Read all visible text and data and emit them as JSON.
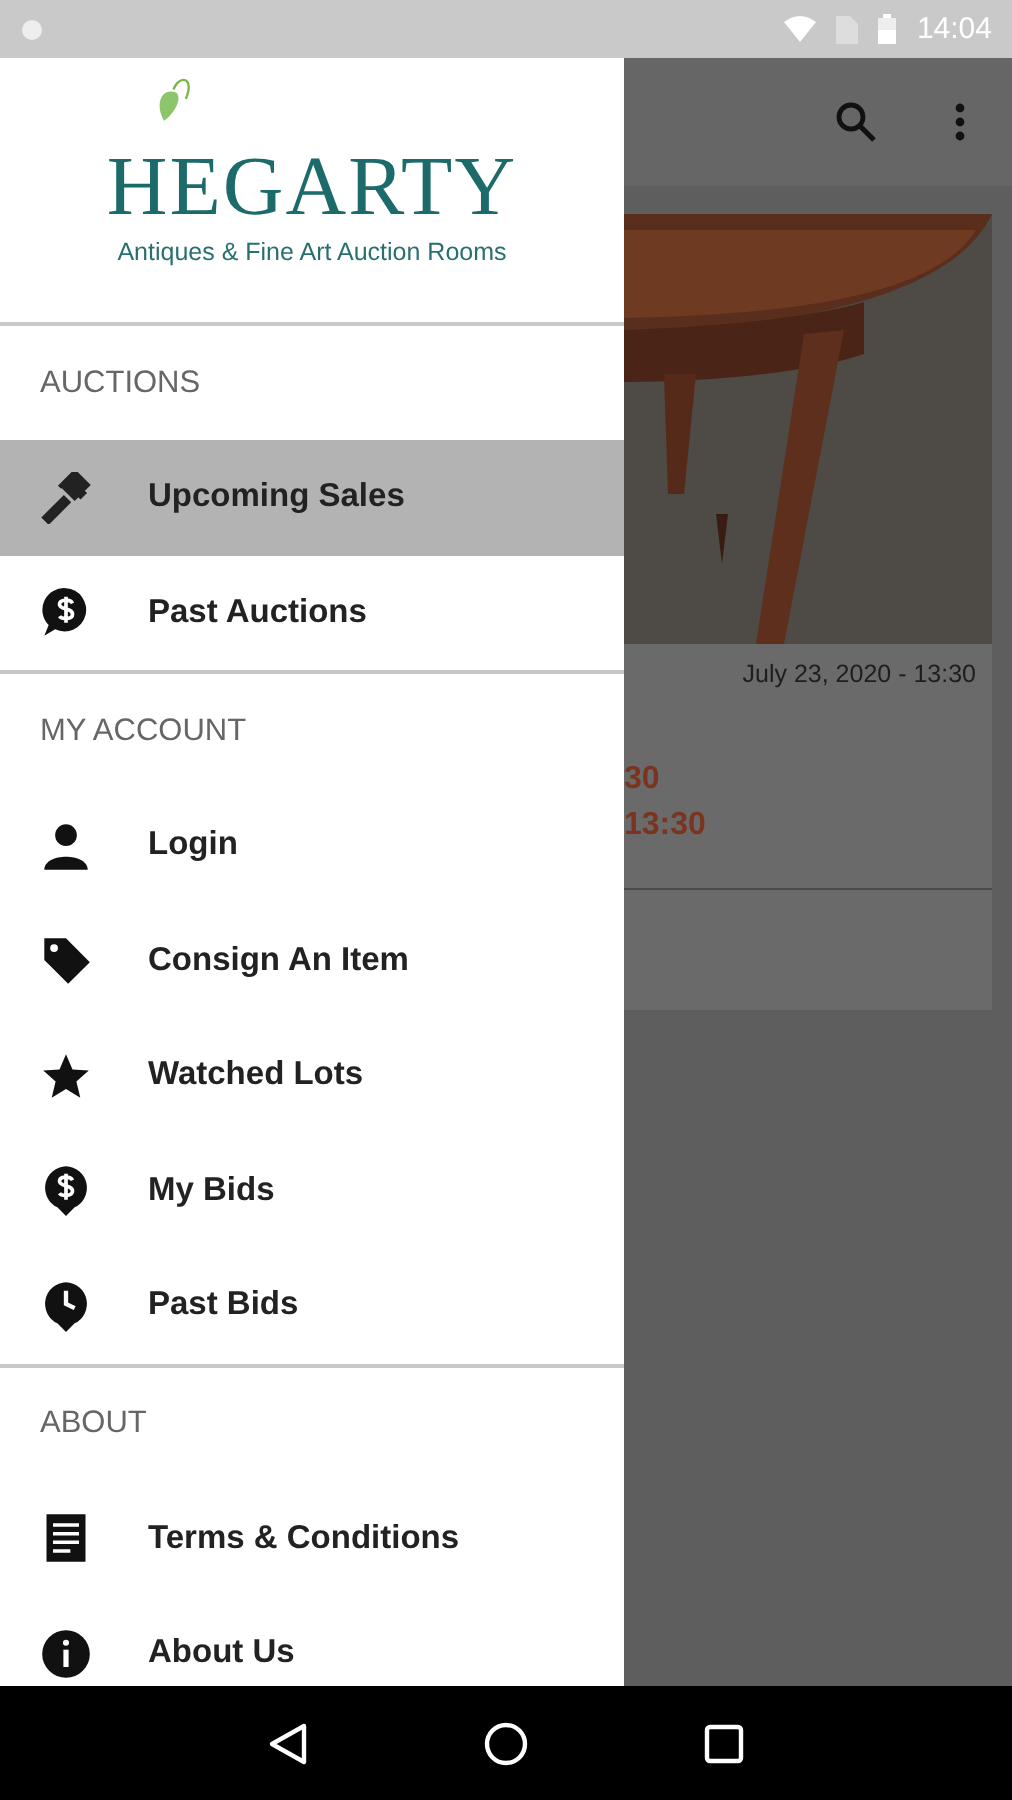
{
  "status_bar": {
    "time": "14:04"
  },
  "drawer": {
    "logo": {
      "name": "HEGARTY",
      "tagline": "Antiques & Fine Art Auction Rooms"
    },
    "sections": [
      {
        "title": "AUCTIONS",
        "items": [
          {
            "label": "Upcoming Sales",
            "kind": "gavel",
            "selected": true
          },
          {
            "label": "Past Auctions",
            "kind": "dollar-bubble",
            "selected": false
          }
        ]
      },
      {
        "title": "MY ACCOUNT",
        "items": [
          {
            "label": "Login",
            "kind": "person",
            "selected": false
          },
          {
            "label": "Consign An Item",
            "kind": "tag",
            "selected": false
          },
          {
            "label": "Watched Lots",
            "kind": "star",
            "selected": false
          },
          {
            "label": "My Bids",
            "kind": "dollar-pin",
            "selected": false
          },
          {
            "label": "Past Bids",
            "kind": "clock-pin",
            "selected": false
          }
        ]
      },
      {
        "title": "ABOUT",
        "items": [
          {
            "label": "Terms & Conditions",
            "kind": "document",
            "selected": false
          },
          {
            "label": "About Us",
            "kind": "info",
            "selected": false
          }
        ]
      }
    ]
  },
  "background": {
    "card": {
      "date": "July 23, 2020 - 13:30",
      "line_1": "30",
      "line_2": "13:30"
    }
  }
}
